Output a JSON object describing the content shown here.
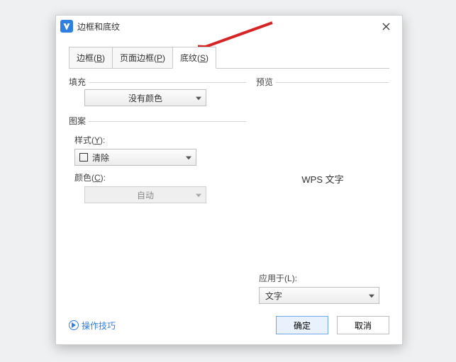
{
  "title": "边框和底纹",
  "tabs": {
    "border": {
      "prefix": "边框(",
      "hotkey": "B",
      "suffix": ")"
    },
    "pageBorder": {
      "prefix": "页面边框(",
      "hotkey": "P",
      "suffix": ")"
    },
    "shading": {
      "prefix": "底纹(",
      "hotkey": "S",
      "suffix": ")"
    }
  },
  "fill": {
    "groupLabel": "填充",
    "value": "没有颜色"
  },
  "pattern": {
    "groupLabel": "图案",
    "styleLabel": {
      "prefix": "样式(",
      "hotkey": "Y",
      "suffix": "):"
    },
    "styleValue": "清除",
    "colorLabel": {
      "prefix": "颜色(",
      "hotkey": "C",
      "suffix": "):"
    },
    "colorValue": "自动"
  },
  "preview": {
    "label": "预览",
    "sample": "WPS 文字"
  },
  "applyTo": {
    "label": {
      "prefix": "应用于(",
      "hotkey": "L",
      "suffix": "):"
    },
    "value": "文字"
  },
  "footer": {
    "tips": "操作技巧",
    "ok": "确定",
    "cancel": "取消"
  }
}
